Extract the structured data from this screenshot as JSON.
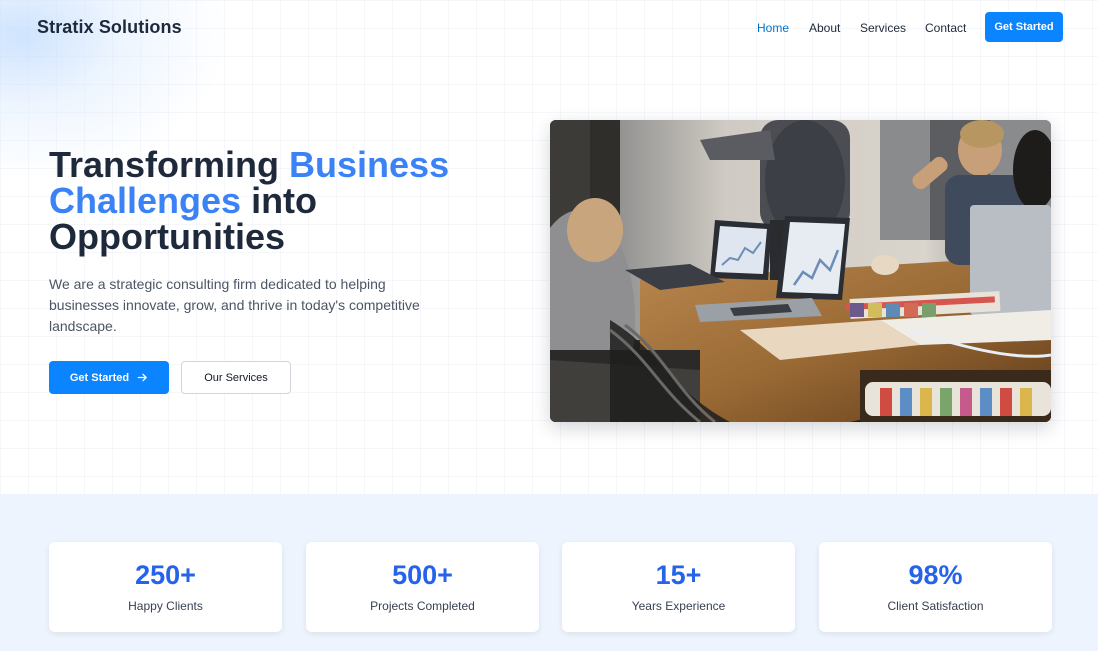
{
  "brand": {
    "name": "Stratix Solutions"
  },
  "nav": {
    "items": [
      {
        "label": "Home",
        "active": true
      },
      {
        "label": "About",
        "active": false
      },
      {
        "label": "Services",
        "active": false
      },
      {
        "label": "Contact",
        "active": false
      }
    ],
    "cta_label": "Get Started"
  },
  "hero": {
    "title_part1": "Transforming ",
    "title_accent": "Business Challenges",
    "title_part2": " into Opportunities",
    "description": "We are a strategic consulting firm dedicated to helping businesses innovate, grow, and thrive in today's competitive landscape.",
    "primary_button": "Get Started",
    "secondary_button": "Our Services",
    "primary_icon": "arrow-right-icon"
  },
  "stats": [
    {
      "value": "250+",
      "label": "Happy Clients"
    },
    {
      "value": "500+",
      "label": "Projects Completed"
    },
    {
      "value": "15+",
      "label": "Years Experience"
    },
    {
      "value": "98%",
      "label": "Client Satisfaction"
    }
  ],
  "colors": {
    "accent": "#3b82f6",
    "button": "#0a84ff",
    "nav_active": "#0073c4",
    "stat_value": "#2563eb",
    "stats_band": "#eef4fd"
  }
}
